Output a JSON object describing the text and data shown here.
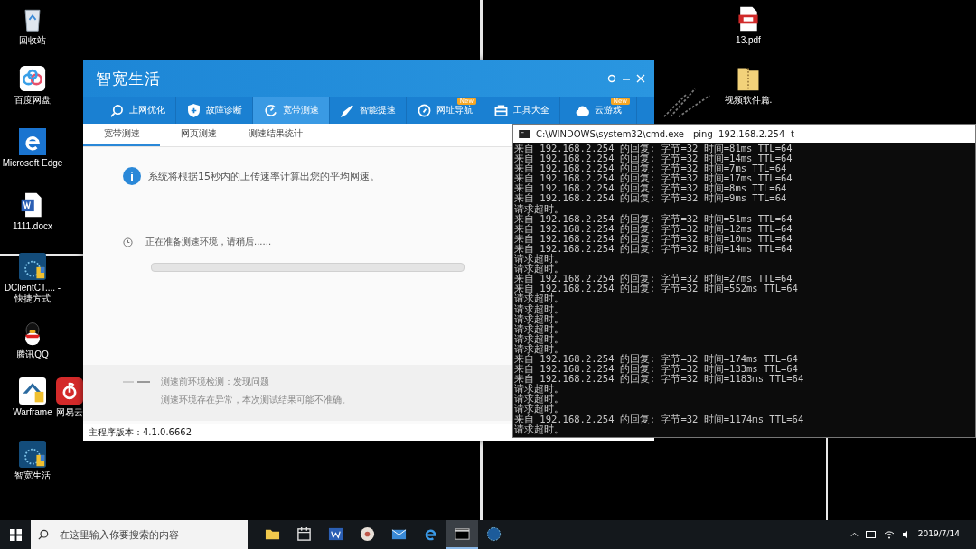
{
  "desktop_icons": [
    {
      "kind": "recycle",
      "label": "回收站"
    },
    {
      "kind": "cloud",
      "label": "百度网盘"
    },
    {
      "kind": "edge",
      "label": "Microsoft Edge"
    },
    {
      "kind": "word",
      "label": "1111.docx"
    },
    {
      "kind": "dclient",
      "label": "DClientCT.... - 快捷方式"
    },
    {
      "kind": "qq",
      "label": "腾讯QQ"
    },
    {
      "kind": "warframe",
      "label": "Warframe"
    },
    {
      "kind": "music",
      "label": "网易云"
    },
    {
      "kind": "dclient",
      "label": "智宽生活"
    },
    {
      "kind": "pdf",
      "label": "13.pdf"
    },
    {
      "kind": "zip",
      "label": "视频软件篇."
    }
  ],
  "app_window": {
    "title": "智宽生活",
    "nav": [
      {
        "label": "上网优化",
        "selected": false
      },
      {
        "label": "故障诊断",
        "selected": false
      },
      {
        "label": "宽带测速",
        "selected": true
      },
      {
        "label": "智能提速",
        "selected": false
      },
      {
        "label": "网址导航",
        "selected": false,
        "badge": "New"
      },
      {
        "label": "工具大全",
        "selected": false
      },
      {
        "label": "云游戏",
        "selected": false,
        "badge": "New"
      }
    ],
    "sub_tabs": [
      {
        "label": "宽带测速",
        "selected": true
      },
      {
        "label": "网页测速",
        "selected": false
      },
      {
        "label": "测速结果统计",
        "selected": false
      }
    ],
    "info": "系统将根据15秒内的上传速率计算出您的平均网速。",
    "status": "正在准备测速环境，请稍后......",
    "progress": {
      "level": 0
    },
    "check_title": "测速前环境检测：发现问题",
    "check_detail": "测速环境存在异常，本次测试结果可能不准确。",
    "version": "主程序版本：4.1.0.6662"
  },
  "cmd_window": {
    "title": "C:\\WINDOWS\\system32\\cmd.exe - ping  192.168.2.254 -t",
    "lines": [
      "来自 192.168.2.254 的回复: 字节=32 时间=81ms TTL=64",
      "来自 192.168.2.254 的回复: 字节=32 时间=14ms TTL=64",
      "来自 192.168.2.254 的回复: 字节=32 时间=7ms TTL=64",
      "来自 192.168.2.254 的回复: 字节=32 时间=17ms TTL=64",
      "来自 192.168.2.254 的回复: 字节=32 时间=8ms TTL=64",
      "来自 192.168.2.254 的回复: 字节=32 时间=9ms TTL=64",
      "请求超时。",
      "来自 192.168.2.254 的回复: 字节=32 时间=51ms TTL=64",
      "来自 192.168.2.254 的回复: 字节=32 时间=12ms TTL=64",
      "来自 192.168.2.254 的回复: 字节=32 时间=10ms TTL=64",
      "来自 192.168.2.254 的回复: 字节=32 时间=14ms TTL=64",
      "请求超时。",
      "请求超时。",
      "来自 192.168.2.254 的回复: 字节=32 时间=27ms TTL=64",
      "来自 192.168.2.254 的回复: 字节=32 时间=552ms TTL=64",
      "请求超时。",
      "请求超时。",
      "请求超时。",
      "请求超时。",
      "请求超时。",
      "请求超时。",
      "来自 192.168.2.254 的回复: 字节=32 时间=174ms TTL=64",
      "来自 192.168.2.254 的回复: 字节=32 时间=133ms TTL=64",
      "来自 192.168.2.254 的回复: 字节=32 时间=1183ms TTL=64",
      "请求超时。",
      "请求超时。",
      "请求超时。",
      "来自 192.168.2.254 的回复: 字节=32 时间=1174ms TTL=64",
      "请求超时。"
    ]
  },
  "taskbar": {
    "search": {
      "placeholder": "在这里输入你要搜索的内容"
    },
    "apps": [
      {
        "kind": "folder",
        "selected": false
      },
      {
        "kind": "calendar",
        "selected": false
      },
      {
        "kind": "word",
        "selected": false
      },
      {
        "kind": "round",
        "selected": false
      },
      {
        "kind": "mail",
        "selected": false
      },
      {
        "kind": "edge",
        "selected": false
      },
      {
        "kind": "console",
        "selected": true
      },
      {
        "kind": "globe",
        "selected": false
      }
    ],
    "date": "2019/7/14"
  }
}
